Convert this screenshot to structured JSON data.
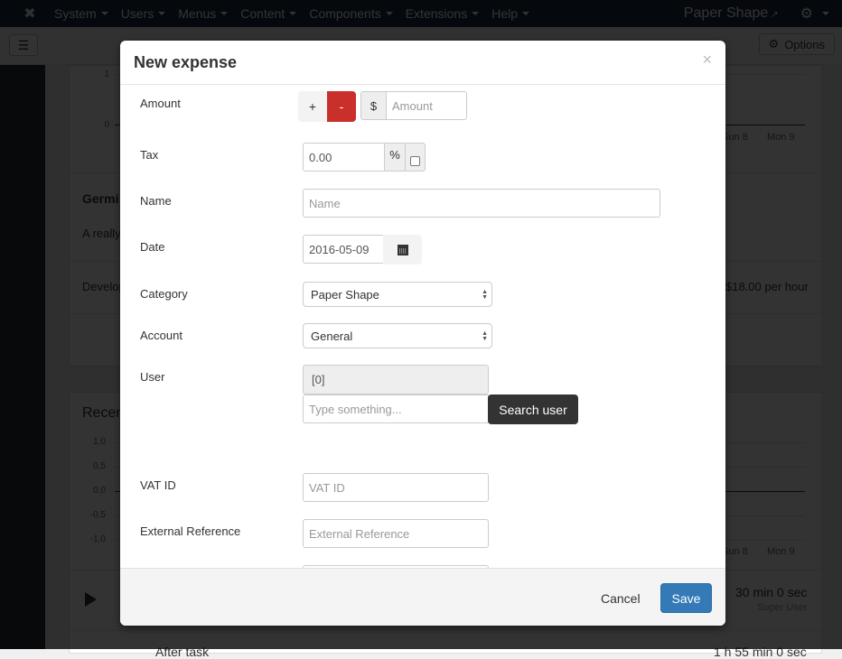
{
  "navbar": {
    "logo_icon": "joomla-logo-icon",
    "menu": [
      "System",
      "Users",
      "Menus",
      "Content",
      "Components",
      "Extensions",
      "Help"
    ],
    "site_name": "Paper Shape",
    "external_icon": "external-link-icon",
    "settings_icon": "gear-icon"
  },
  "subhead": {
    "toggle_icon": "hamburger-icon",
    "options_label": "Options"
  },
  "background": {
    "chart1": {
      "y_ticks": [
        "1",
        "0"
      ],
      "x_ticks": [
        "Sun 8",
        "Mon 9"
      ]
    },
    "project_title": "Germi",
    "project_desc": "A really",
    "rate_label": "Develop",
    "rate_value": "$18.00 per hour",
    "recent_title": "Recen",
    "chart2": {
      "y_ticks": [
        "1,0",
        "0,5",
        "0,0",
        "-0,5",
        "-1,0"
      ],
      "x_ticks": [
        "Sun 8",
        "Mon 9"
      ]
    },
    "entry1": {
      "duration": "30 min 0 sec",
      "user": "Super User"
    },
    "entry2": {
      "title": "After task",
      "duration": "1 h 55 min 0 sec"
    }
  },
  "modal": {
    "title": "New expense",
    "close_icon": "×",
    "fields": {
      "amount": {
        "label": "Amount",
        "plus": "+",
        "minus": "-",
        "currency": "$",
        "placeholder": "Amount",
        "value": ""
      },
      "tax": {
        "label": "Tax",
        "value": "0.00",
        "unit": "%",
        "checked": false
      },
      "name": {
        "label": "Name",
        "placeholder": "Name",
        "value": ""
      },
      "date": {
        "label": "Date",
        "value": "2016-05-09"
      },
      "category": {
        "label": "Category",
        "selected": "Paper Shape"
      },
      "account": {
        "label": "Account",
        "selected": "General"
      },
      "user": {
        "label": "User",
        "value": "[0]",
        "search_placeholder": "Type something...",
        "search_button": "Search user"
      },
      "vat_id": {
        "label": "VAT ID",
        "placeholder": "VAT ID",
        "value": ""
      },
      "external_reference": {
        "label": "External Reference",
        "placeholder": "External Reference",
        "value": ""
      }
    },
    "footer": {
      "cancel": "Cancel",
      "save": "Save"
    }
  }
}
